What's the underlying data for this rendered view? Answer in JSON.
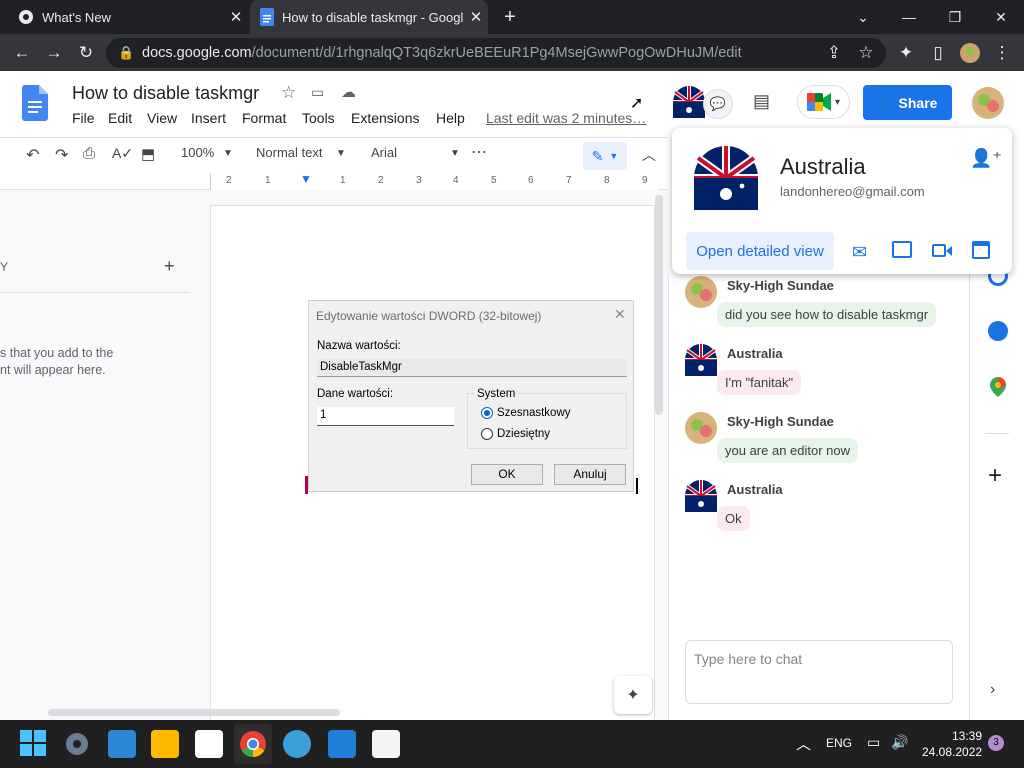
{
  "browser": {
    "tabs": [
      {
        "title": "What's New"
      },
      {
        "title": "How to disable taskmgr - Google"
      }
    ],
    "url_host": "docs.google.com",
    "url_path": "/document/d/1rhgnalqQT3q6zkrUeBEEuR1Pg4MsejGwwPogOwDHuJM/edit"
  },
  "doc": {
    "title": "How to disable taskmgr",
    "menus": [
      "File",
      "Edit",
      "View",
      "Insert",
      "Format",
      "Tools",
      "Extensions",
      "Help"
    ],
    "last_edit": "Last edit was 2 minutes…",
    "share_label": "Share"
  },
  "toolbar": {
    "zoom": "100%",
    "style": "Normal text",
    "font": "Arial"
  },
  "ruler_ticks": [
    "2",
    "1",
    "1",
    "2",
    "3",
    "4",
    "5",
    "6",
    "7",
    "8",
    "9"
  ],
  "outline": {
    "head": "Y",
    "text_line1": "s that you add to the",
    "text_line2": "nt will appear here."
  },
  "dialog": {
    "caption": "Edytowanie wartości DWORD (32-bitowej)",
    "name_label": "Nazwa wartości:",
    "name_value": "DisableTaskMgr",
    "data_label": "Dane wartości:",
    "data_value": "1",
    "base_label": "System",
    "radio_hex": "Szesnastkowy",
    "radio_dec": "Dziesiętny",
    "ok": "OK",
    "cancel": "Anuluj"
  },
  "profile_card": {
    "name": "Australia",
    "email": "landonhereo@gmail.com",
    "open_view": "Open detailed view"
  },
  "chat": {
    "messages": [
      {
        "sender": "Sky-High Sundae",
        "text": "did you see how to disable taskmgr"
      },
      {
        "sender": "Australia",
        "text": "I'm \"fanitak\""
      },
      {
        "sender": "Sky-High Sundae",
        "text": "you are an editor now"
      },
      {
        "sender": "Australia",
        "text": "Ok"
      }
    ],
    "placeholder": "Type here to chat"
  },
  "taskbar": {
    "lang": "ENG",
    "time": "13:39",
    "date": "24.08.2022",
    "notif_count": "3"
  },
  "colors": {
    "accent": "#1a73e8",
    "chrome_dark": "#202124",
    "taskbar": "#202020"
  }
}
